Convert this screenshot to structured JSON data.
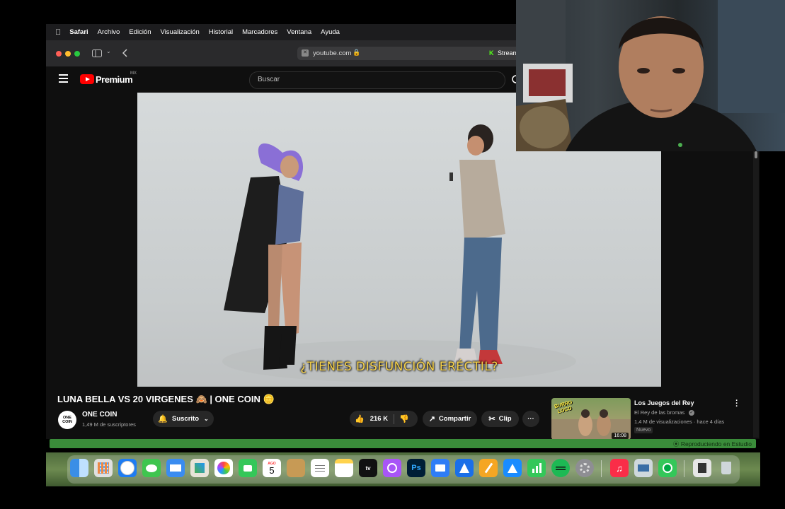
{
  "menubar": {
    "apple": "",
    "app": "Safari",
    "items": [
      "Archivo",
      "Edición",
      "Visualización",
      "Historial",
      "Marcadores",
      "Ventana",
      "Ayuda"
    ]
  },
  "toolbar": {
    "url": "youtube.com",
    "tab_label": "Stream"
  },
  "youtube": {
    "logo": "Premium",
    "region": "MX",
    "search_placeholder": "Buscar"
  },
  "video": {
    "subtitle": "¿TIENES DISFUNCIÓN ERÉCTIL?"
  },
  "info": {
    "title": "LUNA BELLA VS 20 VIRGENES 🙈 | ONE COIN 🪙",
    "channel_avatar": "ONE COIN",
    "channel": "ONE COIN",
    "subscribers": "1,49 M de suscriptores",
    "subscribed_label": "Suscrito",
    "likes": "216 K",
    "share_label": "Compartir",
    "clip_label": "Clip",
    "more": "···"
  },
  "recommendation": {
    "thumb_text": "BURRO LOCO",
    "duration": "16:08",
    "title": "Los Juegos del Rey",
    "channel": "El Rey de las bromas",
    "meta": "1,4 M de visualizaciones · hace 4 días",
    "badge": "Nuevo"
  },
  "status_bar": {
    "label": "Reproduciendo en Estudio"
  },
  "dock": {
    "calendar_month": "AGO",
    "calendar_day": "5",
    "ps_label": "Ps",
    "tv_label": "tv"
  },
  "colors": {
    "youtube_red": "#ff0000",
    "subtitle_yellow": "#f5d04a",
    "green_bar": "#3a8c3a"
  }
}
